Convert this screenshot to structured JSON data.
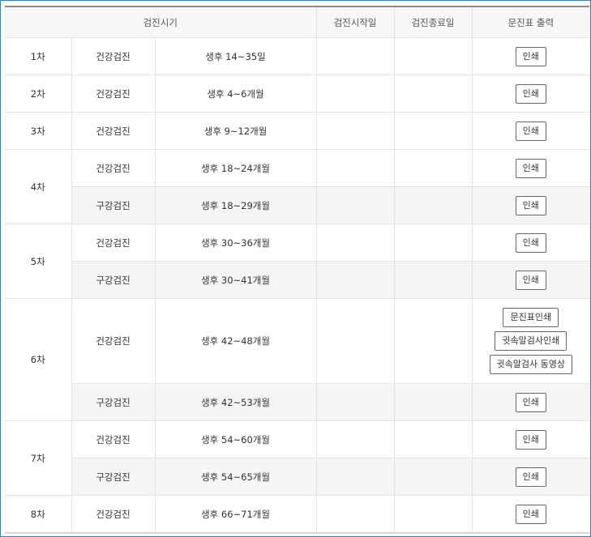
{
  "headers": {
    "period": "검진시기",
    "start": "검진시작일",
    "end": "검진종료일",
    "print": "문진표 출력"
  },
  "rows": [
    {
      "round": "1차",
      "type": "건강검진",
      "age": "생후 14~35일",
      "start": "",
      "end": "",
      "buttons": [
        "인쇄"
      ]
    },
    {
      "round": "2차",
      "type": "건강검진",
      "age": "생후 4~6개월",
      "start": "",
      "end": "",
      "buttons": [
        "인쇄"
      ]
    },
    {
      "round": "3차",
      "type": "건강검진",
      "age": "생후 9~12개월",
      "start": "",
      "end": "",
      "buttons": [
        "인쇄"
      ]
    },
    {
      "round": "4차",
      "type": "건강검진",
      "age": "생후 18~24개월",
      "start": "",
      "end": "",
      "buttons": [
        "인쇄"
      ]
    },
    {
      "type": "구강검진",
      "age": "생후 18~29개월",
      "start": "",
      "end": "",
      "buttons": [
        "인쇄"
      ]
    },
    {
      "round": "5차",
      "type": "건강검진",
      "age": "생후 30~36개월",
      "start": "",
      "end": "",
      "buttons": [
        "인쇄"
      ]
    },
    {
      "type": "구강검진",
      "age": "생후 30~41개월",
      "start": "",
      "end": "",
      "buttons": [
        "인쇄"
      ]
    },
    {
      "round": "6차",
      "type": "건강검진",
      "age": "생후 42~48개월",
      "start": "",
      "end": "",
      "buttons": [
        "문진표인쇄",
        "귓속말검사인쇄",
        "귓속말검사 동영상"
      ]
    },
    {
      "type": "구강검진",
      "age": "생후 42~53개월",
      "start": "",
      "end": "",
      "buttons": [
        "인쇄"
      ]
    },
    {
      "round": "7차",
      "type": "건강검진",
      "age": "생후 54~60개월",
      "start": "",
      "end": "",
      "buttons": [
        "인쇄"
      ]
    },
    {
      "type": "구강검진",
      "age": "생후 54~65개월",
      "start": "",
      "end": "",
      "buttons": [
        "인쇄"
      ]
    },
    {
      "round": "8차",
      "type": "건강검진",
      "age": "생후 66~71개월",
      "start": "",
      "end": "",
      "buttons": [
        "인쇄"
      ]
    }
  ]
}
